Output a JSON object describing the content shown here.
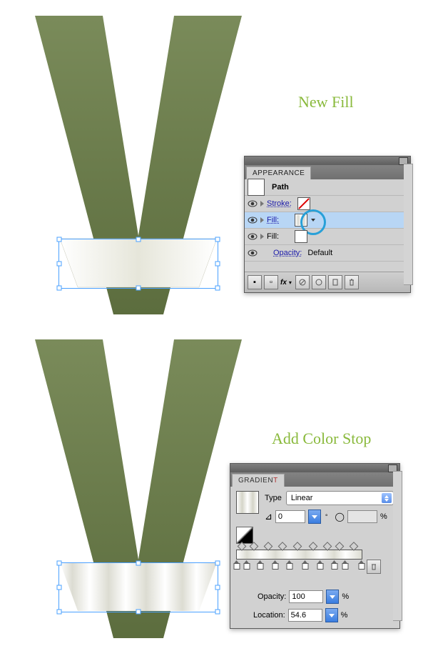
{
  "label_top": "New Fill",
  "label_bottom": "Add Color Stop",
  "appearance_panel": {
    "title": "APPEARANCE",
    "path_label": "Path",
    "stroke_label": "Stroke:",
    "fill_label_1": "Fill:",
    "fill_label_2": "Fill:",
    "opacity_label": "Opacity:",
    "opacity_value": "Default"
  },
  "gradient_panel": {
    "title": "GRADIENT",
    "type_label": "Type",
    "type_value": "Linear",
    "angle_value": "0",
    "aspect_value": "",
    "opacity_label": "Opacity:",
    "opacity_value": "100",
    "opacity_unit": "%",
    "location_label": "Location:",
    "location_value": "54.6",
    "location_unit": "%",
    "ratio_unit": "%",
    "stops": [
      0,
      8,
      19,
      31,
      42,
      55,
      67,
      78,
      87,
      100
    ],
    "diamonds": [
      4,
      13.5,
      25,
      36.5,
      48.5,
      61,
      72.5,
      82.5,
      93.5
    ]
  }
}
